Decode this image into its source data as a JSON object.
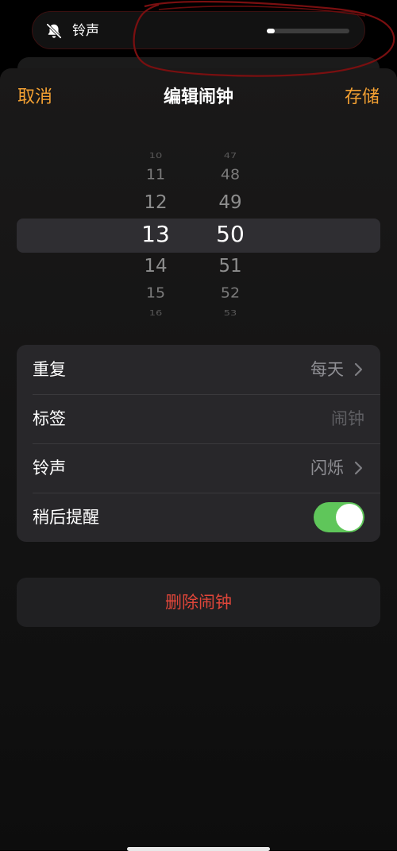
{
  "hud": {
    "label": "铃声",
    "icon": "bell-slash-icon",
    "volume_fraction": 0.1
  },
  "nav": {
    "cancel_label": "取消",
    "title": "编辑闹钟",
    "save_label": "存储"
  },
  "picker": {
    "hours": [
      "10",
      "11",
      "12",
      "13",
      "14",
      "15",
      "16"
    ],
    "minutes": [
      "47",
      "48",
      "49",
      "50",
      "51",
      "52",
      "53"
    ],
    "selected_hour": "13",
    "selected_minute": "50"
  },
  "settings": {
    "repeat": {
      "label": "重复",
      "value": "每天"
    },
    "tag": {
      "label": "标签",
      "placeholder": "闹钟"
    },
    "sound": {
      "label": "铃声",
      "value": "闪烁"
    },
    "snooze": {
      "label": "稍后提醒",
      "enabled": true
    }
  },
  "delete_label": "删除闹钟",
  "colors": {
    "accent": "#f3a032",
    "destructive": "#e0463a",
    "toggle_on": "#5fc65a"
  }
}
